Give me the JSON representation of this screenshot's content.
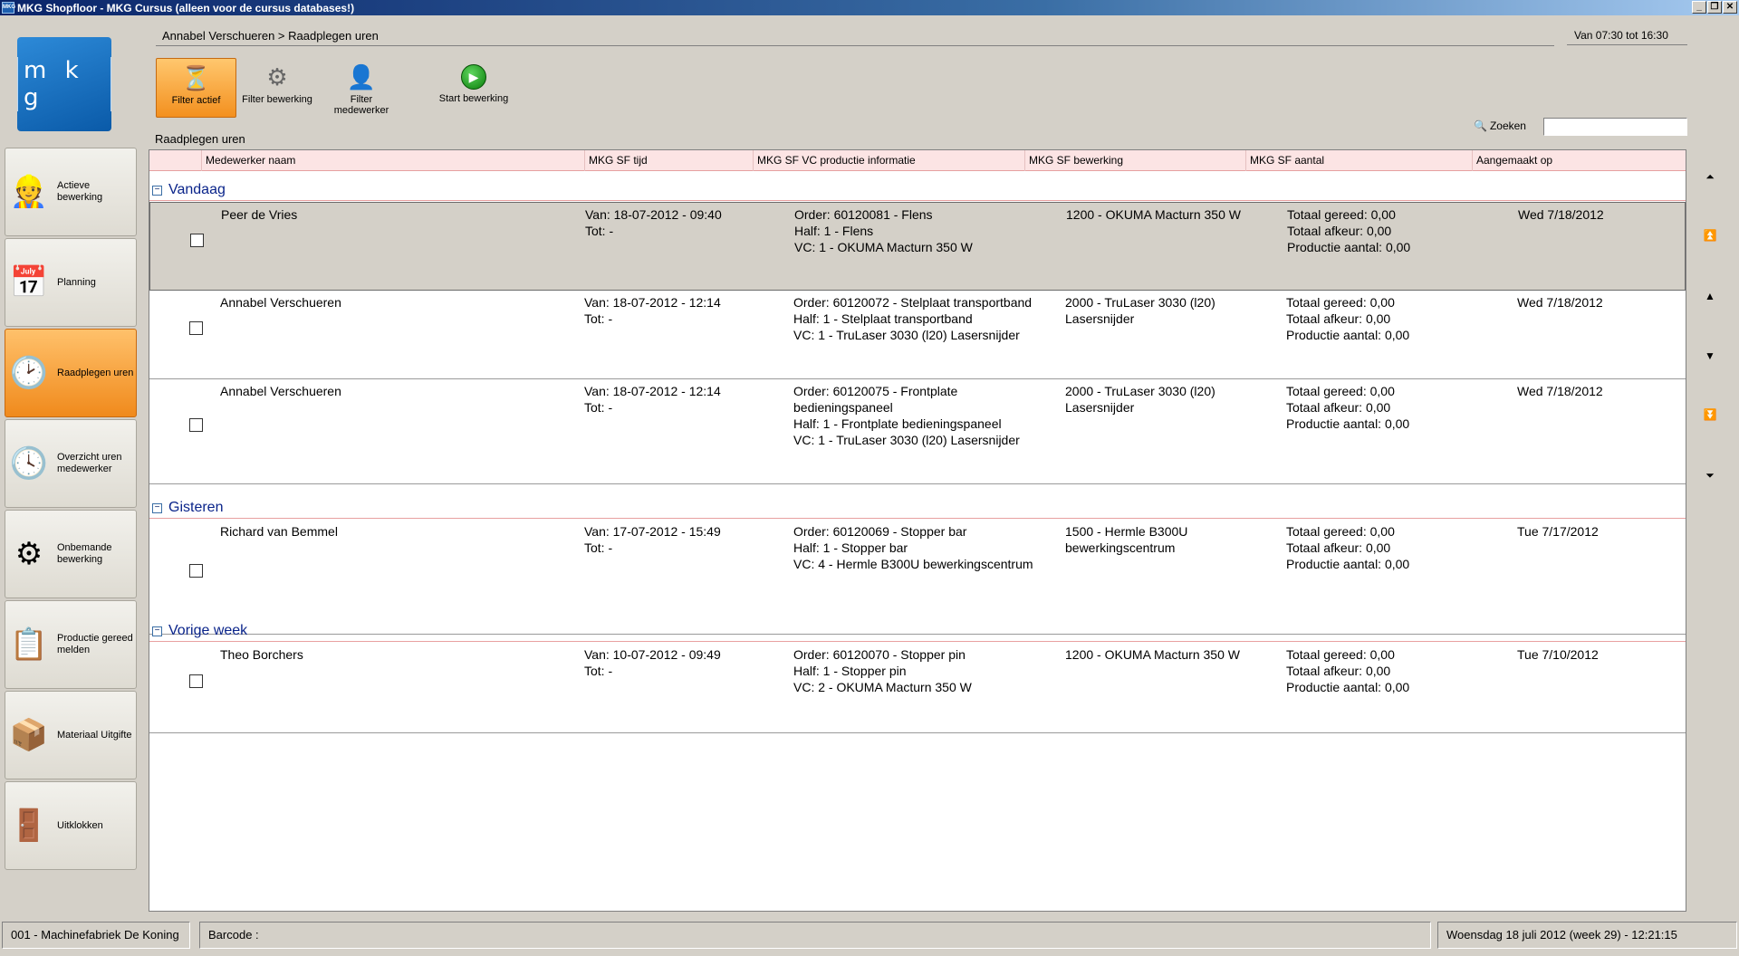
{
  "window": {
    "title": "MKG Shopfloor - MKG Cursus (alleen voor de cursus databases!)",
    "icon_text": "MKG"
  },
  "logo": {
    "text": "m k g"
  },
  "sidebar": {
    "items": [
      {
        "label": "Actieve bewerking",
        "icon": "worker-machine-icon",
        "glyph": "👷"
      },
      {
        "label": "Planning",
        "icon": "calendar-icon",
        "glyph": "📅"
      },
      {
        "label": "Raadplegen uren",
        "icon": "clock-document-icon",
        "glyph": "🕑",
        "active": true
      },
      {
        "label": "Overzicht uren medewerker",
        "icon": "clock-user-icon",
        "glyph": "🕓"
      },
      {
        "label": "Onbemande bewerking",
        "icon": "unmanned-machine-icon",
        "glyph": "⚙"
      },
      {
        "label": "Productie gereed melden",
        "icon": "production-report-icon",
        "glyph": "📋"
      },
      {
        "label": "Materiaal Uitgifte",
        "icon": "material-issue-icon",
        "glyph": "📦"
      },
      {
        "label": "Uitklokken",
        "icon": "clock-out-door-icon",
        "glyph": "🚪"
      }
    ]
  },
  "breadcrumb": "Annabel Verschueren > Raadplegen uren",
  "shift": "Van 07:30 tot 16:30",
  "toolbar": {
    "filter_active": "Filter actief",
    "filter_operation": "Filter bewerking",
    "filter_employee": "Filter medewerker",
    "start_operation": "Start bewerking"
  },
  "search": {
    "label": "Zoeken",
    "value": ""
  },
  "section_title": "Raadplegen uren",
  "columns": [
    "Medewerker naam",
    "MKG SF tijd",
    "MKG SF VC productie informatie",
    "MKG SF bewerking",
    "MKG SF aantal",
    "Aangemaakt op"
  ],
  "groups": [
    {
      "label": "Vandaag",
      "rows": [
        {
          "name": "Peer de Vries",
          "time": "Van: 18-07-2012 - 09:40\nTot:  -",
          "info": "Order: 60120081 - Flens\nHalf: 1 - Flens\nVC: 1 - OKUMA Macturn 350 W",
          "operation": "1200 - OKUMA Macturn 350 W",
          "qty": "Totaal gereed: 0,00\nTotaal afkeur: 0,00\nProductie aantal: 0,00",
          "created": "Wed 7/18/2012",
          "selected": true
        },
        {
          "name": "Annabel Verschueren",
          "time": "Van: 18-07-2012 - 12:14\nTot:  -",
          "info": "Order: 60120072 - Stelplaat transportband\nHalf: 1 - Stelplaat transportband\nVC: 1 - TruLaser 3030 (l20) Lasersnijder",
          "operation": "2000 - TruLaser 3030 (l20)\nLasersnijder",
          "qty": "Totaal gereed: 0,00\nTotaal afkeur: 0,00\nProductie aantal: 0,00",
          "created": "Wed 7/18/2012"
        },
        {
          "name": "Annabel Verschueren",
          "time": "Van: 18-07-2012 - 12:14\nTot:  -",
          "info": "Order: 60120075 - Frontplate\nbedieningspaneel\nHalf: 1 - Frontplate bedieningspaneel\nVC: 1 - TruLaser 3030 (l20) Lasersnijder",
          "operation": "2000 - TruLaser 3030 (l20)\nLasersnijder",
          "qty": "Totaal gereed: 0,00\nTotaal afkeur: 0,00\nProductie aantal: 0,00",
          "created": "Wed 7/18/2012"
        }
      ]
    },
    {
      "label": "Gisteren",
      "rows": [
        {
          "name": "Richard van Bemmel",
          "time": "Van: 17-07-2012 - 15:49\nTot:  -",
          "info": "Order: 60120069 - Stopper bar\nHalf: 1 - Stopper bar\nVC: 4 - Hermle B300U bewerkingscentrum",
          "operation": "1500 - Hermle B300U\nbewerkingscentrum",
          "qty": "Totaal gereed: 0,00\nTotaal afkeur: 0,00\nProductie aantal: 0,00",
          "created": "Tue 7/17/2012"
        }
      ]
    },
    {
      "label": "Vorige week",
      "rows": [
        {
          "name": "Theo Borchers",
          "time": "Van: 10-07-2012 - 09:49\nTot:  -",
          "info": "Order: 60120070 - Stopper pin\nHalf: 1 - Stopper pin\nVC: 2 - OKUMA Macturn 350 W",
          "operation": "1200 - OKUMA Macturn 350 W",
          "qty": "Totaal gereed: 0,00\nTotaal afkeur: 0,00\nProductie aantal: 0,00",
          "created": "Tue 7/10/2012"
        }
      ]
    }
  ],
  "statusbar": {
    "company": "001 - Machinefabriek De Koning",
    "barcode": "Barcode :",
    "datetime": "Woensdag 18 juli 2012 (week 29) - 12:21:15"
  },
  "colors": {
    "accent_orange": "#f08a1c",
    "header_pink": "#fce4e4",
    "group_blue": "#0a248a"
  }
}
